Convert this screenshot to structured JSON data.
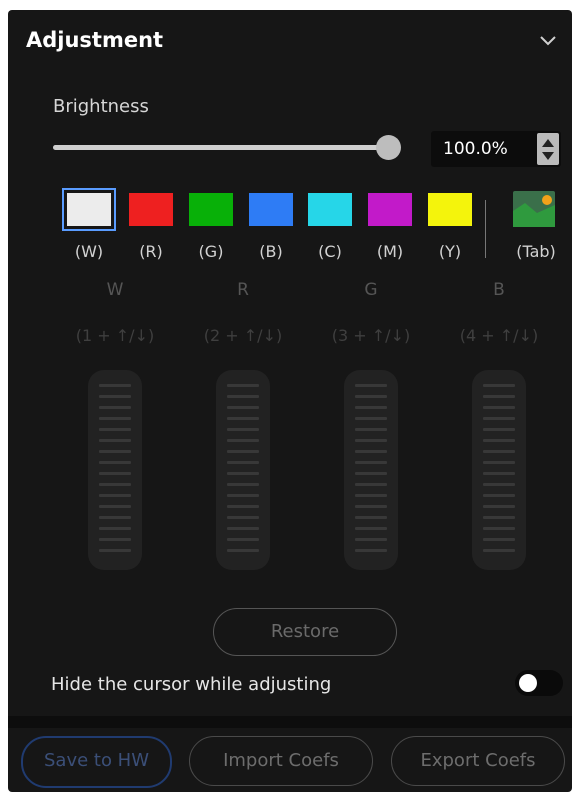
{
  "header": {
    "title": "Adjustment"
  },
  "brightness": {
    "label": "Brightness",
    "value_text": "100.0%",
    "value_percent": 100
  },
  "swatches": [
    {
      "color": "#ececec",
      "label": "(W)",
      "selected": true
    },
    {
      "color": "#ee2020",
      "label": "(R)",
      "selected": false
    },
    {
      "color": "#08b008",
      "label": "(G)",
      "selected": false
    },
    {
      "color": "#2e7cf5",
      "label": "(B)",
      "selected": false
    },
    {
      "color": "#26d6e8",
      "label": "(C)",
      "selected": false
    },
    {
      "color": "#c21ac9",
      "label": "(M)",
      "selected": false
    },
    {
      "color": "#f4f40c",
      "label": "(Y)",
      "selected": false
    }
  ],
  "tab_swatch": {
    "label": "(Tab)",
    "icon": "image-icon"
  },
  "channels": [
    {
      "name": "W",
      "shortcut": "(1 + ↑/↓)"
    },
    {
      "name": "R",
      "shortcut": "(2 + ↑/↓)"
    },
    {
      "name": "G",
      "shortcut": "(3 + ↑/↓)"
    },
    {
      "name": "B",
      "shortcut": "(4 + ↑/↓)"
    }
  ],
  "restore_label": "Restore",
  "hide_cursor": {
    "label": "Hide the cursor while adjusting",
    "enabled": false
  },
  "footer": {
    "save_label": "Save to HW",
    "import_label": "Import Coefs",
    "export_label": "Export Coefs"
  },
  "colors": {
    "accent": "#5a9cff",
    "panel_bg": "#161616"
  }
}
